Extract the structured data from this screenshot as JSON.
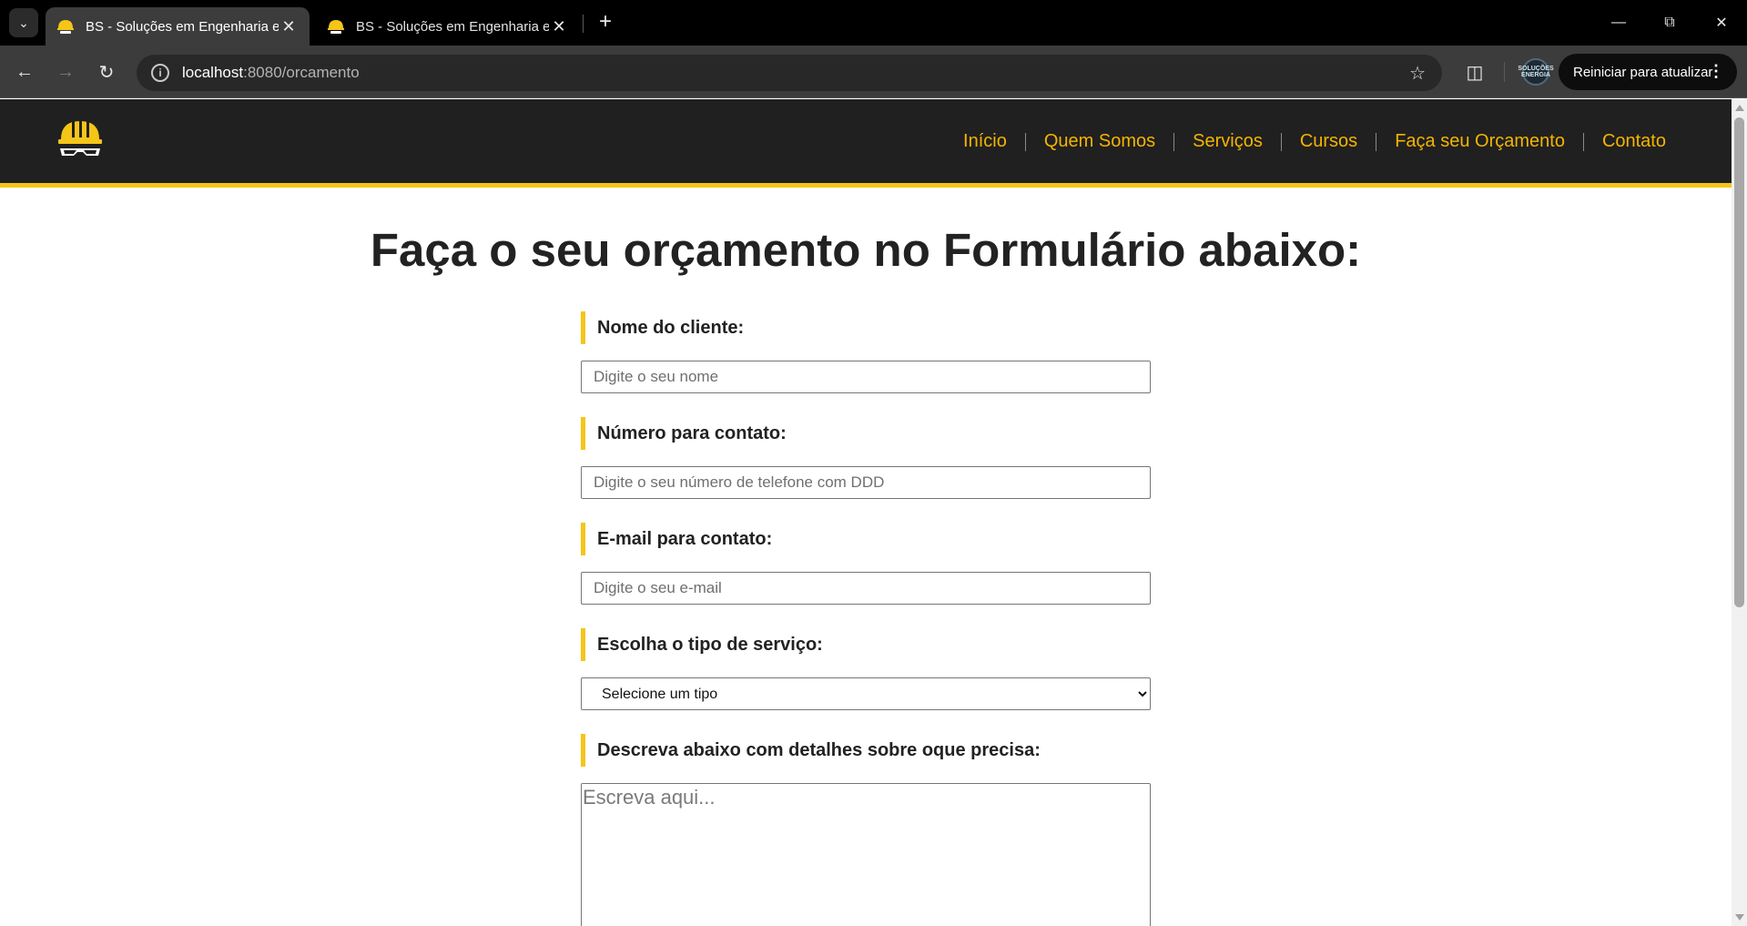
{
  "browser": {
    "tabs": [
      {
        "title": "BS - Soluções em Engenharia e",
        "active": true
      },
      {
        "title": "BS - Soluções em Engenharia e",
        "active": false
      }
    ],
    "address": {
      "host": "localhost",
      "rest": ":8080/orcamento"
    },
    "profile_text": "SOLUÇÕES ENERGIA",
    "update_label": "Reiniciar para atualizar"
  },
  "site": {
    "nav": [
      "Início",
      "Quem Somos",
      "Serviços",
      "Cursos",
      "Faça seu Orçamento",
      "Contato"
    ],
    "accent_color": "#f5c518",
    "nav_color": "#f5b400",
    "header_bg": "#202020"
  },
  "page": {
    "title": "Faça o seu orçamento no Formulário abaixo:",
    "form": {
      "name_label": "Nome do cliente:",
      "name_placeholder": "Digite o seu nome",
      "phone_label": "Número para contato:",
      "phone_placeholder": "Digite o seu número de telefone com DDD",
      "email_label": "E-mail para contato:",
      "email_placeholder": "Digite o seu e-mail",
      "service_label": "Escolha o tipo de serviço:",
      "service_selected": "Selecione um tipo",
      "details_label": "Descreva abaixo com detalhes sobre oque precisa:",
      "details_placeholder": "Escreva aqui..."
    }
  }
}
